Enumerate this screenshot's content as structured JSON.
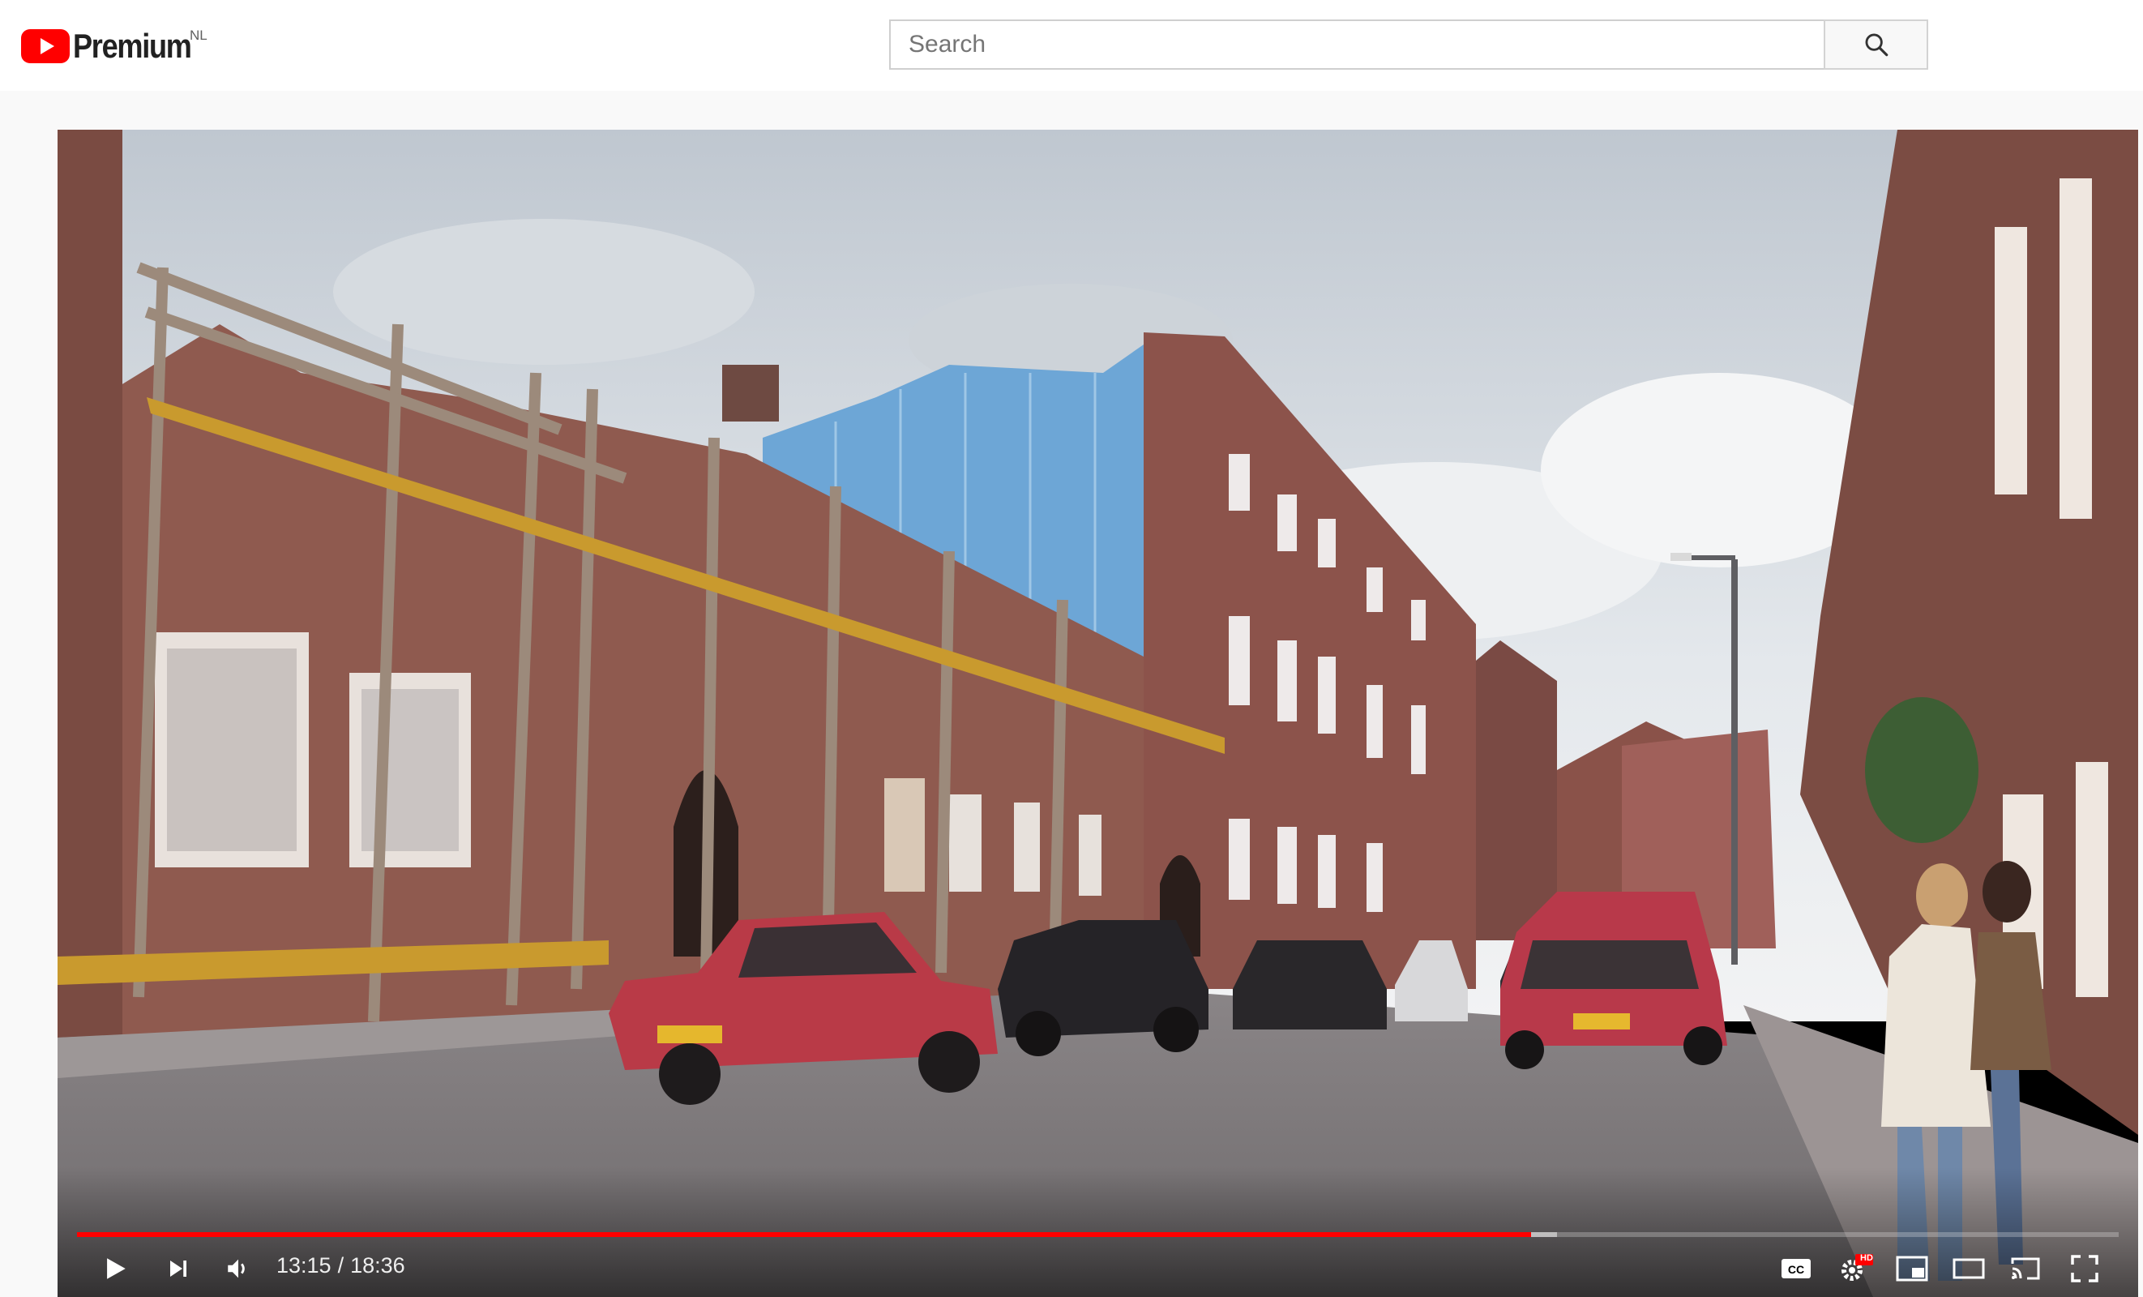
{
  "masthead": {
    "logo_text": "Premium",
    "region": "NL",
    "brand_color": "#ff0000"
  },
  "search": {
    "placeholder": "Search",
    "value": ""
  },
  "player": {
    "current_time": "13:15",
    "duration": "18:36",
    "progress_played_fraction": 0.712,
    "progress_loaded_fraction": 0.725,
    "progress_color": "#ff0000",
    "hd_badge": "HD",
    "icons": [
      "play-icon",
      "next-icon",
      "volume-icon",
      "captions-icon",
      "settings-icon",
      "miniplayer-icon",
      "theater-icon",
      "cast-icon",
      "fullscreen-icon"
    ]
  }
}
